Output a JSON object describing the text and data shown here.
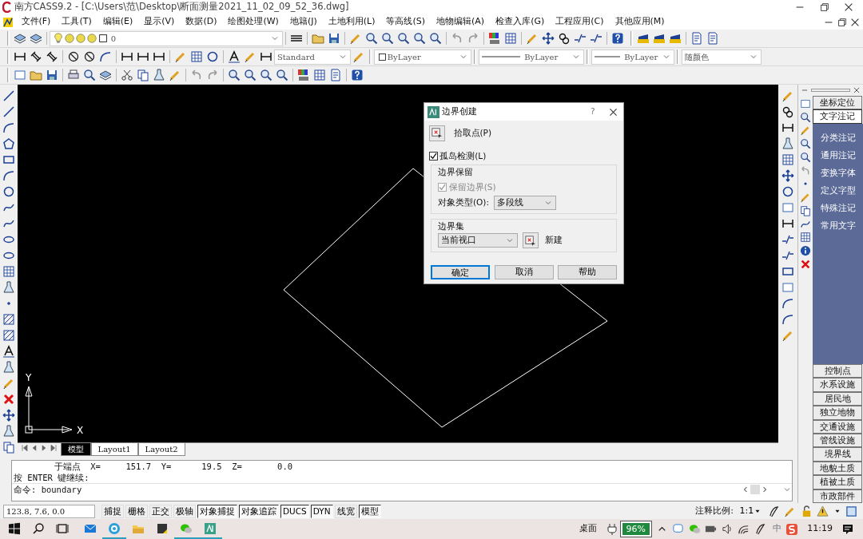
{
  "window": {
    "title": "南方CASS9.2 - [C:\\Users\\范\\Desktop\\断面测量2021_11_02_09_52_36.dwg]"
  },
  "menu": [
    "文件(F)",
    "工具(T)",
    "编辑(E)",
    "显示(V)",
    "数据(D)",
    "绘图处理(W)",
    "地籍(J)",
    "土地利用(L)",
    "等高线(S)",
    "地物编辑(A)",
    "检查入库(G)",
    "工程应用(C)",
    "其他应用(M)"
  ],
  "toolbars": {
    "layer": "0",
    "text_style": "Standard",
    "color_setting": "ByLayer",
    "linetype": "ByLayer",
    "lineweight": "ByLayer",
    "plot_style": "随颜色"
  },
  "drawing": {
    "axis_y": "Y",
    "axis_x": "X"
  },
  "layout_tabs": [
    {
      "label": "模型",
      "selected": true
    },
    {
      "label": "Layout1",
      "selected": false
    },
    {
      "label": "Layout2",
      "selected": false
    }
  ],
  "command": {
    "history": [
      "        于端点  X=     151.7  Y=      19.5  Z=       0.0",
      "按 ENTER 键继续:"
    ],
    "prompt": "命令: boundary"
  },
  "dialog": {
    "title": "边界创建",
    "help": "?",
    "pick_points": "拾取点(P)",
    "island_detection": {
      "label": "孤岛检测(L)",
      "checked": true
    },
    "retain": {
      "legend": "边界保留",
      "checkbox": {
        "label": "保留边界(S)",
        "checked": true,
        "disabled": true
      },
      "object_type_label": "对象类型(O):",
      "object_type": "多段线"
    },
    "boundary_set": {
      "legend": "边界集",
      "value": "当前视口",
      "new": "新建"
    },
    "buttons": [
      {
        "label": "确定",
        "default": true
      },
      {
        "label": "取消",
        "default": false
      },
      {
        "label": "帮助",
        "default": false
      }
    ]
  },
  "panel": {
    "sections": [
      {
        "label": "坐标定位",
        "expanded": false
      },
      {
        "label": "文字注记",
        "expanded": true,
        "children": [
          "分类注记",
          "通用注记",
          "变换字体",
          "定义字型",
          "特殊注记",
          "常用文字"
        ]
      },
      {
        "label": "控制点",
        "expanded": false
      },
      {
        "label": "水系设施",
        "expanded": false
      },
      {
        "label": "居民地",
        "expanded": false
      },
      {
        "label": "独立地物",
        "expanded": false
      },
      {
        "label": "交通设施",
        "expanded": false
      },
      {
        "label": "管线设施",
        "expanded": false
      },
      {
        "label": "境界线",
        "expanded": false
      },
      {
        "label": "地貌土质",
        "expanded": false
      },
      {
        "label": "植被土质",
        "expanded": false
      },
      {
        "label": "市政部件",
        "expanded": false
      }
    ]
  },
  "status_bar": {
    "coordinates": "123.8, 7.6, 0.0",
    "toggles": [
      {
        "label": "捕捉",
        "on": false
      },
      {
        "label": "栅格",
        "on": false
      },
      {
        "label": "正交",
        "on": false
      },
      {
        "label": "极轴",
        "on": false
      },
      {
        "label": "对象捕捉",
        "on": true
      },
      {
        "label": "对象追踪",
        "on": true
      },
      {
        "label": "DUCS",
        "on": true
      },
      {
        "label": "DYN",
        "on": true
      },
      {
        "label": "线宽",
        "on": false
      },
      {
        "label": "模型",
        "on": true
      }
    ],
    "annotation_scale_label": "注释比例:",
    "annotation_scale": "1:1"
  },
  "taskbar": {
    "apps": [
      {
        "running": false
      },
      {
        "running": true
      },
      {
        "running": false
      },
      {
        "running": false
      },
      {
        "running": true
      },
      {
        "running": true
      }
    ],
    "desktop": "桌面",
    "battery": "96%",
    "ime": "中",
    "clock": "11:19"
  }
}
